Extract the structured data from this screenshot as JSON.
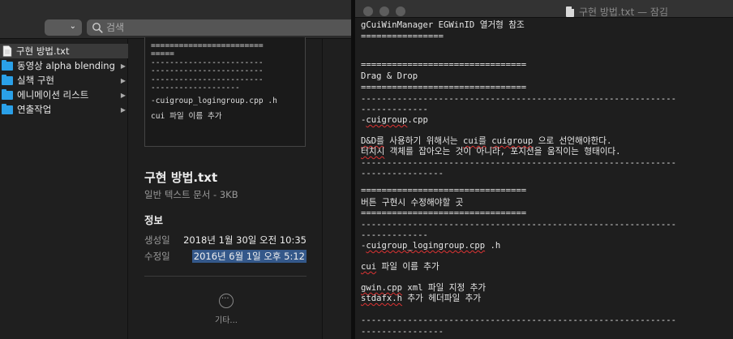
{
  "finder": {
    "search": {
      "placeholder": "검색"
    },
    "files": [
      {
        "label": "구현 방법.txt",
        "kind": "file",
        "selected": true
      },
      {
        "label": "동영상 alpha blending",
        "kind": "folder"
      },
      {
        "label": "실책 구현",
        "kind": "folder"
      },
      {
        "label": "에니메이션 리스트",
        "kind": "folder"
      },
      {
        "label": "연출작업",
        "kind": "folder"
      }
    ],
    "preview": {
      "thumb_lines": [
        "========================",
        "=====",
        "------------------------",
        "------------------------",
        "------------------------",
        "-------------------",
        "-cuigroup_logingroup.cpp .h",
        "",
        "cui 파일 이름 추가"
      ],
      "file_name": "구현 방법.txt",
      "file_type": "일반 텍스트 문서 - 3KB",
      "info_heading": "정보",
      "created_label": "생성일",
      "created_value": "2018년 1월 30일 오전 10:35",
      "modified_label": "수정일",
      "modified_value": "2016년 6월 1일 오후 5:12",
      "more_label": "기타..."
    }
  },
  "editor": {
    "title": "구현 방법.txt — 잠김",
    "lines": [
      "gCuiWinManager EGWinID 열거형 참조",
      "================",
      "",
      "================================",
      "Drag & Drop",
      "================================",
      "-------------------------------------------------------------",
      "-------------",
      "-cuigroup.cpp",
      "",
      "D&D를 사용하기 위해서는 cui를 cuigroup 으로 선언해야한다.",
      "터치시 객체를 잡아오는 것이 아니라, 포지션을 움직이는 형태이다.",
      "-------------------------------------------------------------",
      "----------------",
      "",
      "================================",
      "버튼 구현시 수정해야할 곳",
      "================================",
      "-------------------------------------------------------------",
      "-------------",
      "-cuigroup_logingroup.cpp .h",
      "",
      "cui 파일 이름 추가",
      "",
      "gwin.cpp xml 파일 지정 추가",
      "stdafx.h 추가 헤더파일 추가",
      "",
      "-------------------------------------------------------------",
      "----------------"
    ]
  },
  "colors": {
    "selection": "#34588a",
    "folder": "#2aa0e8",
    "spellcheck": "#dd3333"
  }
}
